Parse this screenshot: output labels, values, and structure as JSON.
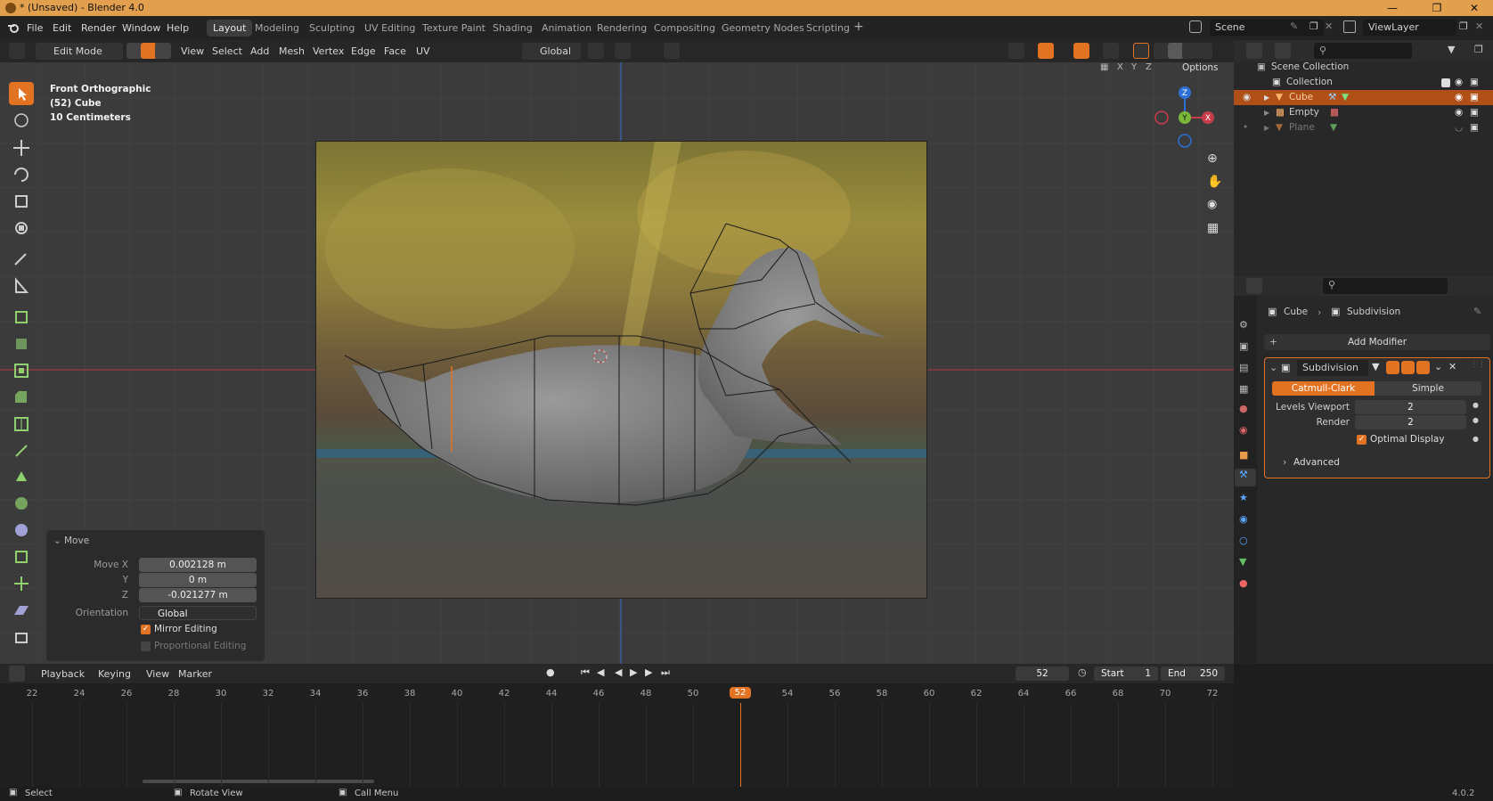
{
  "window": {
    "title": "* (Unsaved) - Blender 4.0"
  },
  "menu": [
    "File",
    "Edit",
    "Render",
    "Window",
    "Help"
  ],
  "workspaces": [
    "Layout",
    "Modeling",
    "Sculpting",
    "UV Editing",
    "Texture Paint",
    "Shading",
    "Animation",
    "Rendering",
    "Compositing",
    "Geometry Nodes",
    "Scripting"
  ],
  "scene": {
    "name": "Scene",
    "view_layer": "ViewLayer"
  },
  "viewport_header": {
    "mode": "Edit Mode",
    "menus": [
      "View",
      "Select",
      "Add",
      "Mesh",
      "Vertex",
      "Edge",
      "Face",
      "UV"
    ],
    "orientation": "Global",
    "options": "Options",
    "axes": [
      "X",
      "Y",
      "Z"
    ]
  },
  "viewport_info": {
    "line1": "Front Orthographic",
    "line2": "(52) Cube",
    "line3": "10 Centimeters"
  },
  "gizmo": {
    "z": "Z",
    "y": "Y",
    "x": "X"
  },
  "move_panel": {
    "title": "Move",
    "move_x_label": "Move X",
    "move_x": "0.002128 m",
    "y_label": "Y",
    "y": "0 m",
    "z_label": "Z",
    "z": "-0.021277 m",
    "orientation_label": "Orientation",
    "orientation": "Global",
    "mirror": "Mirror Editing",
    "proportional": "Proportional Editing"
  },
  "outliner": {
    "root": "Scene Collection",
    "items": [
      {
        "label": "Collection"
      },
      {
        "label": "Cube"
      },
      {
        "label": "Empty"
      },
      {
        "label": "Plane"
      }
    ]
  },
  "properties": {
    "breadcrumb_object": "Cube",
    "breadcrumb_modifier": "Subdivision",
    "add_modifier": "Add Modifier",
    "modifier_name": "Subdivision",
    "tab_catmull": "Catmull-Clark",
    "tab_simple": "Simple",
    "levels_viewport_label": "Levels Viewport",
    "levels_viewport": "2",
    "render_label": "Render",
    "render": "2",
    "optimal_display": "Optimal Display",
    "advanced": "Advanced"
  },
  "timeline": {
    "menus": [
      "Playback",
      "Keying",
      "View",
      "Marker"
    ],
    "current_frame": "52",
    "start_label": "Start",
    "start": "1",
    "end_label": "End",
    "end": "250",
    "ticks": [
      "22",
      "24",
      "26",
      "28",
      "30",
      "32",
      "34",
      "36",
      "38",
      "40",
      "42",
      "44",
      "46",
      "48",
      "50",
      "52",
      "54",
      "56",
      "58",
      "60",
      "62",
      "64",
      "66",
      "68",
      "70",
      "72"
    ]
  },
  "statusbar": {
    "select": "Select",
    "rotate": "Rotate View",
    "call_menu": "Call Menu",
    "version": "4.0.2"
  },
  "colors": {
    "accent": "#e27323",
    "titlebar": "#e2a04f",
    "viewport_bg": "#3b3b3b",
    "x_axis": "#c83c4a",
    "y_axis": "#2d6fd6"
  }
}
